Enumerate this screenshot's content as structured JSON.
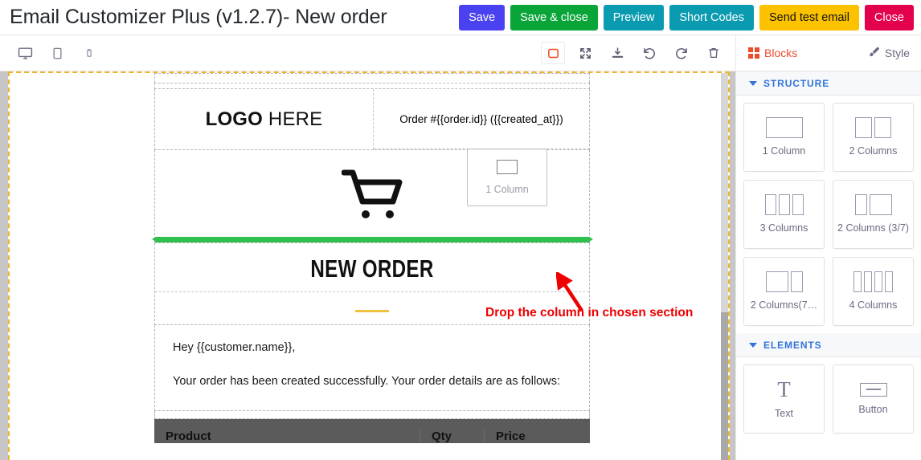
{
  "header": {
    "title": "Email Customizer Plus (v1.2.7)- New order",
    "buttons": [
      {
        "label": "Save",
        "name": "save-button",
        "color": "#4a42f0"
      },
      {
        "label": "Save & close",
        "name": "save-and-close-button",
        "color": "#0aa538"
      },
      {
        "label": "Preview",
        "name": "preview-button",
        "color": "#0a9bb0"
      },
      {
        "label": "Short Codes",
        "name": "short-codes-button",
        "color": "#0a9bb0"
      },
      {
        "label": "Send test email",
        "name": "send-test-email-button",
        "color": "#fcc200",
        "text_color": "#111111"
      },
      {
        "label": "Close",
        "name": "close-button",
        "color": "#e3004c"
      }
    ]
  },
  "toolbar": {
    "devices": [
      {
        "icon": "desktop-icon",
        "title": "Desktop"
      },
      {
        "icon": "tablet-icon",
        "title": "Tablet"
      },
      {
        "icon": "mobile-icon",
        "title": "Mobile"
      }
    ],
    "edit_actions": [
      {
        "icon": "borders-toggle-icon",
        "title": "View components",
        "active": true
      },
      {
        "icon": "fullscreen-icon",
        "title": "Fullscreen"
      },
      {
        "icon": "import-icon",
        "title": "Import/Export"
      },
      {
        "icon": "undo-icon",
        "title": "Undo"
      },
      {
        "icon": "redo-icon",
        "title": "Redo"
      },
      {
        "icon": "trash-icon",
        "title": "Clear canvas"
      }
    ]
  },
  "panel": {
    "tabs": {
      "blocks_label": "Blocks",
      "style_label": "Style",
      "active": "Blocks",
      "active_color": "#eb4b2d"
    },
    "sections": [
      {
        "title": "STRUCTURE",
        "name": "structure",
        "blocks": [
          {
            "label": "1 Column",
            "name": "block-1-column",
            "cols": [
              46
            ]
          },
          {
            "label": "2 Columns",
            "name": "block-2-columns",
            "cols": [
              21,
              21
            ]
          },
          {
            "label": "3 Columns",
            "name": "block-3-columns",
            "cols": [
              14,
              14,
              14
            ]
          },
          {
            "label": "2 Columns (3/7)",
            "name": "block-2-columns-3-7",
            "cols": [
              15,
              28
            ]
          },
          {
            "label": "2 Columns(7…",
            "name": "block-2-columns-7-3",
            "cols": [
              28,
              15
            ]
          },
          {
            "label": "4 Columns",
            "name": "block-4-columns",
            "cols": [
              10,
              10,
              10,
              10
            ]
          }
        ]
      },
      {
        "title": "ELEMENTS",
        "name": "elements",
        "blocks": [
          {
            "label": "Text",
            "name": "block-text",
            "glyph": "T"
          },
          {
            "label": "Button",
            "name": "block-button",
            "glyph": "button"
          }
        ]
      }
    ]
  },
  "canvas": {
    "logo": {
      "bold": "LOGO",
      "regular": " HERE"
    },
    "order_meta": "Order #{{order.id}} ({{created_at}})",
    "cart_icon": "shopping-cart-icon",
    "heading": "NEW ORDER",
    "divider_color": "#f0c040",
    "greeting": "Hey {{customer.name}},",
    "body": "Your order has been created successfully. Your order details are as follows:",
    "table": {
      "columns": [
        "Product",
        "Qty",
        "Price"
      ]
    },
    "drop_indicator_color": "#2fc04f"
  },
  "drag": {
    "ghost_label": "1 Column",
    "annotation": "Drop the column in chosen section",
    "annotation_color": "#ee0000"
  }
}
